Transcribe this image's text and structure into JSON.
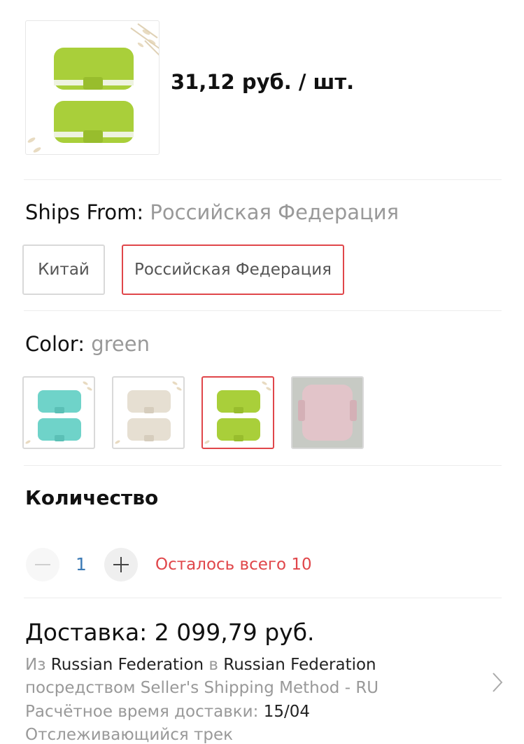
{
  "product": {
    "price": "31,12 руб. / шт.",
    "image_icon": "pill-box-green-image"
  },
  "ships_from": {
    "label": "Ships From:",
    "selected": "Российская Федерация",
    "options": [
      "Китай",
      "Российская Федерация"
    ]
  },
  "color": {
    "label": "Color:",
    "selected": "green",
    "swatches": [
      "teal",
      "beige",
      "green",
      "pink"
    ]
  },
  "quantity": {
    "label": "Количество",
    "value": "1",
    "stock_text": "Осталось всего 10"
  },
  "delivery": {
    "title": "Доставка: 2 099,79 руб.",
    "from_prefix": "Из",
    "from": "Russian Federation",
    "to_prefix": "в",
    "to": "Russian Federation",
    "method": "посредством Seller's Shipping Method - RU",
    "eta_label": "Расчётное время доставки:",
    "eta_value": "15/04",
    "tracking": "Отслеживающийся трек"
  },
  "colors": {
    "accent_red": "#e0464a",
    "qty_blue": "#3b7ab5",
    "box_green": "#a9cf3a",
    "box_teal": "#6fd3c9",
    "box_beige": "#e6dfd2",
    "box_pink": "#e2c4c9"
  }
}
